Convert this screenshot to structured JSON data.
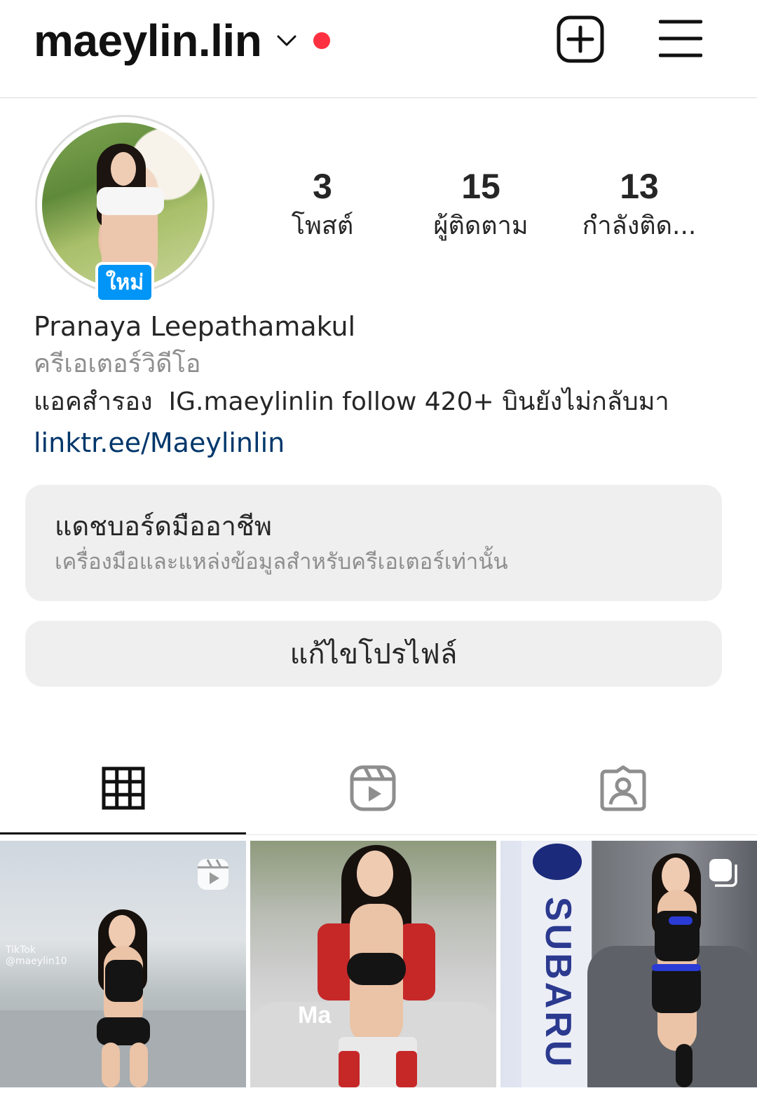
{
  "header": {
    "username": "maeylin.lin",
    "icons": {
      "dropdown": "chevron-down-icon",
      "notification": "red-dot",
      "new_post": "plus-square-icon",
      "menu": "hamburger-icon"
    },
    "notification_color": "#ff3040"
  },
  "profile": {
    "avatar_badge": "ใหม่",
    "stats": {
      "posts": {
        "value": "3",
        "label": "โพสต์"
      },
      "followers": {
        "value": "15",
        "label": "ผู้ติดตาม"
      },
      "following": {
        "value": "13",
        "label": "กำลังติด..."
      }
    },
    "full_name": "Pranaya Leepathamakul",
    "category": "ครีเอเตอร์วิดีโอ",
    "bio": "แอคสำรอง  IG.maeylinlin follow 420+ บินยังไม่กลับมา",
    "link": "linktr.ee/Maeylinlin"
  },
  "dashboard": {
    "title": "แดชบอร์ดมืออาชีพ",
    "subtitle": "เครื่องมือและแหล่งข้อมูลสำหรับครีเอเตอร์เท่านั้น"
  },
  "actions": {
    "edit_profile": "แก้ไขโปรไฟล์"
  },
  "tabs": [
    {
      "name": "grid",
      "icon": "grid-icon",
      "active": true
    },
    {
      "name": "reels",
      "icon": "reels-icon",
      "active": false
    },
    {
      "name": "tagged",
      "icon": "tagged-person-icon",
      "active": false
    }
  ],
  "posts": [
    {
      "type": "reel",
      "badge_icon": "reels-icon",
      "watermark": "TikTok\n@maeylin10"
    },
    {
      "type": "photo",
      "overlay_text": "Ma"
    },
    {
      "type": "carousel",
      "badge_icon": "carousel-icon",
      "overlay_text": "SUBARU"
    }
  ],
  "colors": {
    "accent_blue": "#0095f6",
    "link": "#00376b",
    "secondary_text": "#8e8e8e",
    "button_bg": "#efefef"
  }
}
